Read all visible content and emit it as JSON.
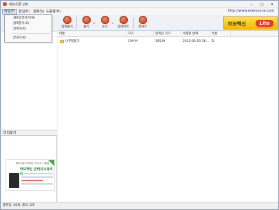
{
  "window": {
    "title": "에브리존 ZIP",
    "controls": {
      "minimize": "–",
      "maximize": "□",
      "close": "✕"
    }
  },
  "menu": {
    "items": [
      {
        "label": "파일(F)"
      },
      {
        "label": "편집(E)"
      },
      {
        "label": "설정(S)"
      },
      {
        "label": "도움말(H)"
      }
    ],
    "url": "http://www.everyzone.com"
  },
  "file_menu": {
    "items": [
      {
        "label": "새로압축하기(N)"
      },
      {
        "label": "압축열기(O)"
      },
      {
        "label": "압축하(X)"
      },
      {
        "label": "끝내기(X)"
      }
    ]
  },
  "toolbar": {
    "buttons": [
      {
        "label": "압축풀기",
        "icon": "extract-icon"
      },
      {
        "label": "풀기",
        "icon": "unzip-icon"
      },
      {
        "label": "보기",
        "icon": "view-icon"
      },
      {
        "label": "업데이트",
        "icon": "update-icon"
      },
      {
        "label": "끝내기",
        "icon": "exit-icon"
      }
    ],
    "dropdown_arrow": "▾",
    "banner": {
      "text": "터보백신",
      "badge": "Lite"
    }
  },
  "preview": {
    "title": "미리보기",
    "ad": {
      "headline": "에브리존 터보백신 라이트 사용중",
      "title": "터보백신 인터넷시큐리티"
    }
  },
  "filelist": {
    "columns": [
      "이름",
      "크기",
      "압축된 크기",
      "수정된 날짜",
      "속성"
    ],
    "rows": [
      {
        "name": "나무향림기",
        "size": "199 M",
        "packed": "195 M",
        "modified": "2013-02-19 16:...",
        "attr": "D"
      }
    ]
  },
  "status": {
    "text": "총파일: 26개, 폴더: 2개"
  },
  "colors": {
    "accent": "#1a3a8a",
    "banner": "#f5b800",
    "banner_badge": "#e63b2a",
    "toolbar_icon": "#c23a1e"
  }
}
